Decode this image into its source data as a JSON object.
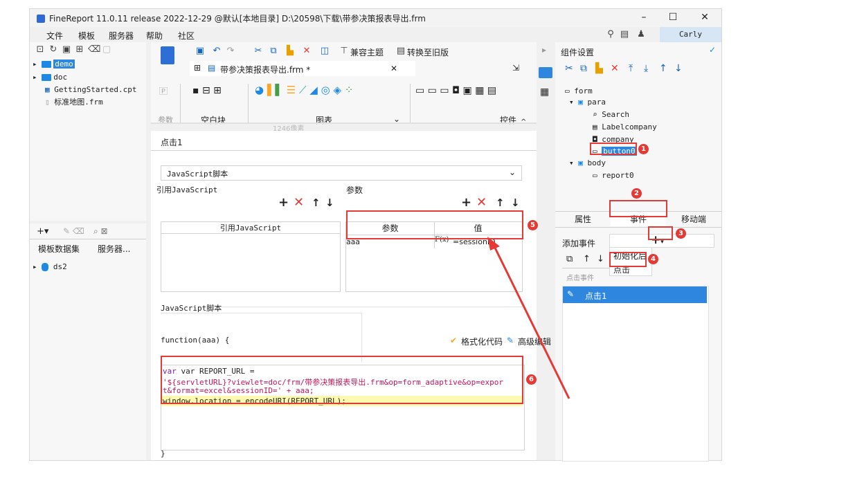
{
  "window": {
    "title": "FineReport 11.0.11 release 2022-12-29 @默认[本地目录]   D:\\20598\\下载\\带参决策报表导出.frm",
    "minimize": "–",
    "maximize": "☐",
    "close": "✕"
  },
  "menu": {
    "items": [
      "文件",
      "模板",
      "服务器",
      "帮助",
      "社区"
    ]
  },
  "user": {
    "name": "Carly"
  },
  "file_tree": {
    "items": [
      {
        "label": "demo"
      },
      {
        "label": "doc"
      },
      {
        "label": "GettingStarted.cpt"
      },
      {
        "label": "标准地图.frm"
      }
    ]
  },
  "dataset_panel": {
    "tabs": [
      "模板数据集",
      "服务器..."
    ],
    "items": [
      "ds2"
    ]
  },
  "editor": {
    "top_buttons": [
      "兼容主题",
      "转换至旧版"
    ],
    "file_tab": "带参决策报表导出.frm *",
    "file_tab_close": "✕",
    "widget_groups": [
      "参数",
      "空白块",
      "图表",
      "控件"
    ],
    "ruler_text": "1246像素"
  },
  "event_dialog": {
    "header": "点击1",
    "dropdown": "JavaScript脚本",
    "ref_js_label": "引用JavaScript",
    "params_label": "参数",
    "ref_js_column": "引用JavaScript",
    "params_columns": [
      "参数",
      "值"
    ],
    "param_row": {
      "name": "aaa",
      "fx": "F(x)",
      "value": "=sessionID"
    },
    "js_script_label": "JavaScript脚本",
    "function_header": "function(aaa) {",
    "format_code": "格式化代码",
    "advanced_edit": "高级编辑",
    "code_line1": "var REPORT_URL =",
    "code_line2": "'${servletURL}?viewlet=doc/frm/带参决策报表导出.frm&op=form_adaptive&op=expor",
    "code_line3": "t&format=excel&sessionID=' + aaa;",
    "code_line4": "window.location = encodeURI(REPORT_URL);",
    "closing_brace": "}"
  },
  "component_settings": {
    "title": "组件设置",
    "tree": [
      {
        "label": "form"
      },
      {
        "label": "para"
      },
      {
        "label": "Search"
      },
      {
        "label": "Labelcompany"
      },
      {
        "label": "company"
      },
      {
        "label": "button0"
      },
      {
        "label": "body"
      },
      {
        "label": "report0"
      }
    ],
    "tabs": [
      "属性",
      "事件",
      "移动端"
    ],
    "add_event_label": "添加事件",
    "add_menu": [
      "初始化后",
      "点击"
    ],
    "event_group_label": "点击事件",
    "event_item": "点击1"
  },
  "annotations": [
    "1",
    "2",
    "3",
    "4",
    "5",
    "6"
  ],
  "colors": {
    "accent": "#2e86de",
    "annotation": "#e53935",
    "highlight": "#fdfab0"
  }
}
